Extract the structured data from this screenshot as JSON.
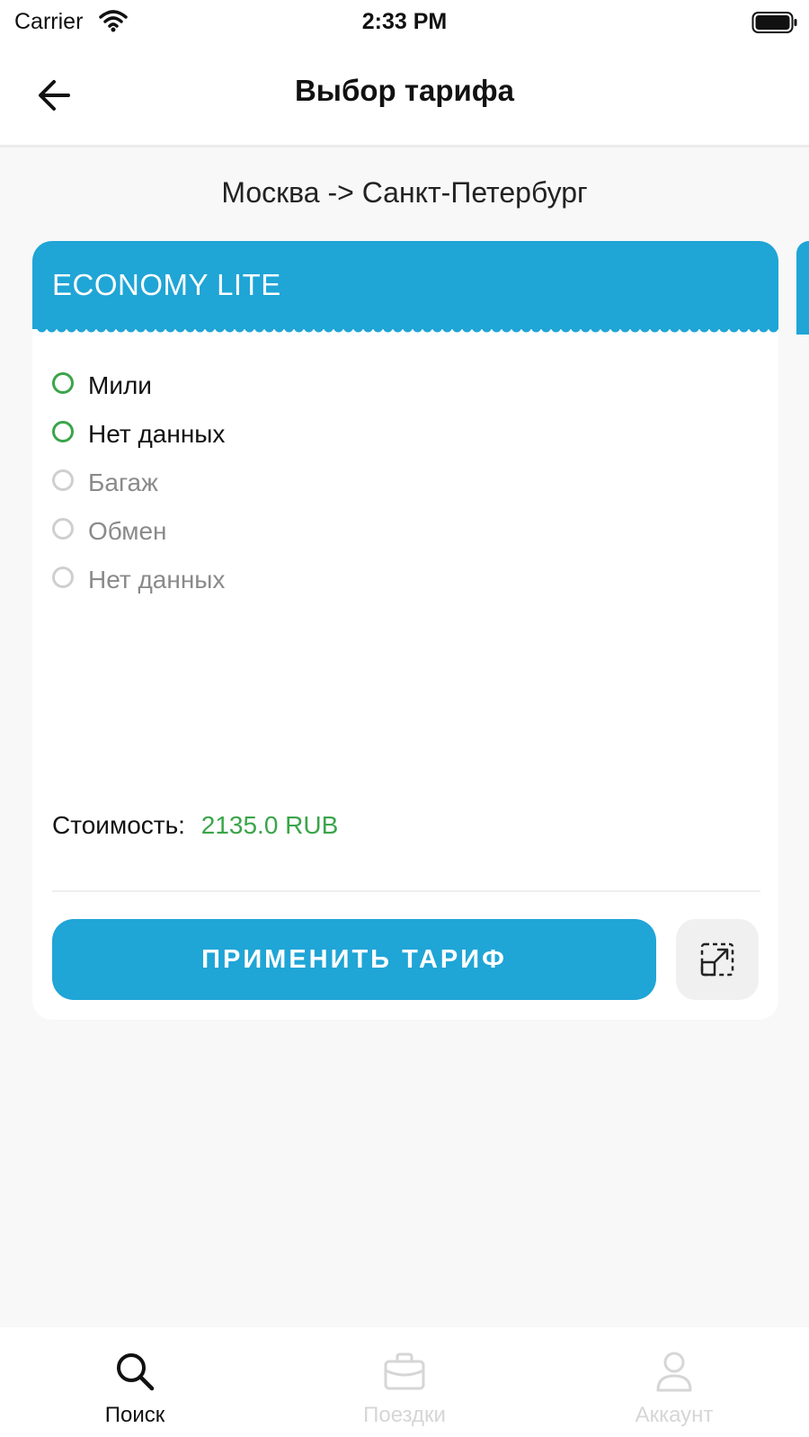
{
  "status_bar": {
    "carrier": "Carrier",
    "time": "2:33 PM",
    "wifi_icon": "wifi-icon",
    "battery_icon": "battery-icon"
  },
  "header": {
    "title": "Выбор тарифа",
    "back_icon": "arrow-left-icon"
  },
  "route": "Москва -> Санкт-Петербург",
  "tariff": {
    "name": "ECONOMY LITE",
    "features": [
      {
        "label": "Мили",
        "included": true
      },
      {
        "label": "Нет данных",
        "included": true
      },
      {
        "label": "Багаж",
        "included": false
      },
      {
        "label": "Обмен",
        "included": false
      },
      {
        "label": "Нет данных",
        "included": false
      }
    ],
    "price_label": "Стоимость:",
    "price_value": "2135.0 RUB",
    "apply_label": "ПРИМЕНИТЬ ТАРИФ",
    "expand_icon": "expand-icon"
  },
  "tabs": [
    {
      "label": "Поиск",
      "icon": "search-icon",
      "active": true
    },
    {
      "label": "Поездки",
      "icon": "briefcase-icon",
      "active": false
    },
    {
      "label": "Аккаунт",
      "icon": "user-icon",
      "active": false
    }
  ],
  "colors": {
    "accent": "#1fa5d6",
    "included": "#3aa54a",
    "price": "#3aa54a",
    "inactive": "#d6d6d6"
  }
}
